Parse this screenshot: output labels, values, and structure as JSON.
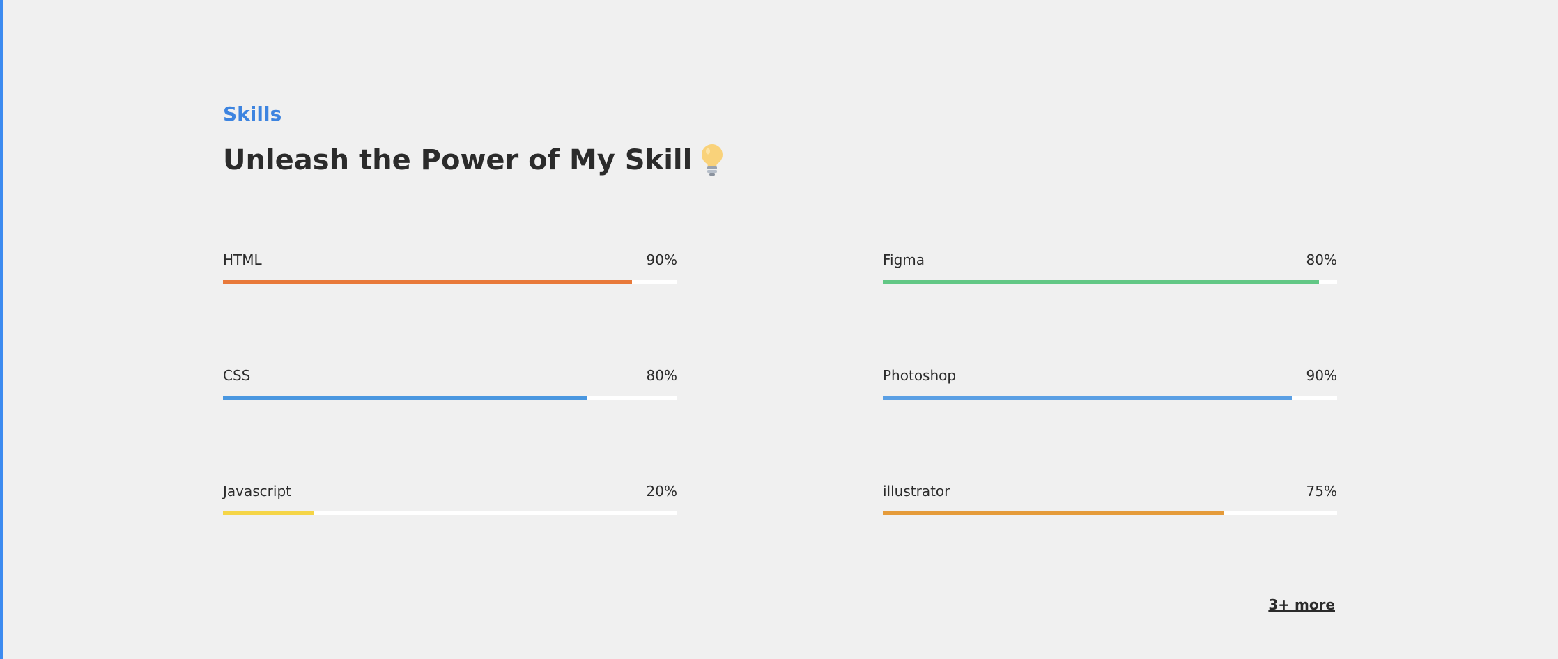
{
  "section": {
    "eyebrow": "Skills",
    "heading": "Unleash the Power of My Skill",
    "heading_icon": "lightbulb-icon",
    "more_label": "3+ more"
  },
  "colors": {
    "accent": "#3d84e0",
    "track": "#ffffff"
  },
  "skills": [
    {
      "name": "HTML",
      "percent_label": "90%",
      "fill_fraction": 0.9,
      "color": "#e8793a"
    },
    {
      "name": "Figma",
      "percent_label": "80%",
      "fill_fraction": 0.96,
      "color": "#62c785"
    },
    {
      "name": "CSS",
      "percent_label": "80%",
      "fill_fraction": 0.8,
      "color": "#4a97e0"
    },
    {
      "name": "Photoshop",
      "percent_label": "90%",
      "fill_fraction": 0.9,
      "color": "#5a9fe4"
    },
    {
      "name": "Javascript",
      "percent_label": "20%",
      "fill_fraction": 0.2,
      "color": "#f5d547"
    },
    {
      "name": "illustrator",
      "percent_label": "75%",
      "fill_fraction": 0.75,
      "color": "#e59b3a"
    }
  ]
}
